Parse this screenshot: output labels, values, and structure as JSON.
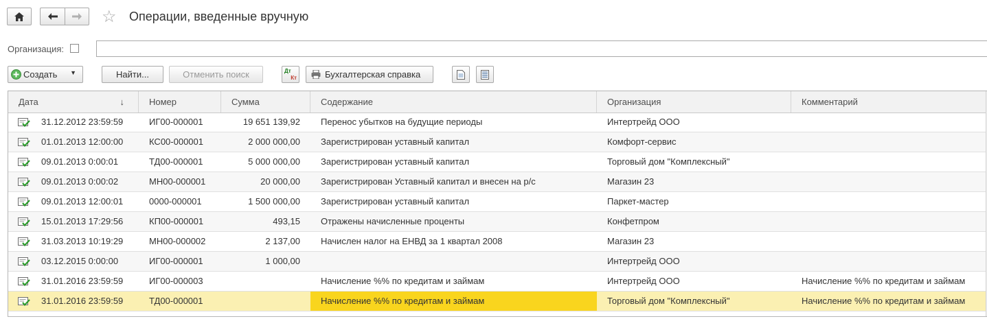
{
  "header": {
    "title": "Операции, введенные вручную"
  },
  "filter": {
    "org_label": "Организация:",
    "org_value": ""
  },
  "toolbar": {
    "create_label": "Создать",
    "find_label": "Найти...",
    "cancel_search_label": "Отменить поиск",
    "report_label": "Бухгалтерская справка",
    "dtkt_icon_text_top": "Дт",
    "dtkt_icon_text_bottom": "Кт"
  },
  "table": {
    "columns": [
      "Дата",
      "Номер",
      "Сумма",
      "Содержание",
      "Организация",
      "Комментарий"
    ],
    "sort_indicator": "↓",
    "rows": [
      {
        "date": "31.12.2012 23:59:59",
        "number": "ИГ00-000001",
        "sum": "19 651 139,92",
        "content": "Перенос убытков на будущие периоды",
        "org": "Интертрейд ООО",
        "comment": ""
      },
      {
        "date": "01.01.2013 12:00:00",
        "number": "КС00-000001",
        "sum": "2 000 000,00",
        "content": "Зарегистрирован уставный капитал",
        "org": "Комфорт-сервис",
        "comment": ""
      },
      {
        "date": "09.01.2013 0:00:01",
        "number": "ТД00-000001",
        "sum": "5 000 000,00",
        "content": "Зарегистрирован уставный капитал",
        "org": "Торговый дом \"Комплексный\"",
        "comment": ""
      },
      {
        "date": "09.01.2013 0:00:02",
        "number": "МН00-000001",
        "sum": "20 000,00",
        "content": "Зарегистрирован Уставный капитал и внесен на р/с",
        "org": "Магазин 23",
        "comment": ""
      },
      {
        "date": "09.01.2013 12:00:01",
        "number": "0000-000001",
        "sum": "1 500 000,00",
        "content": "Зарегистрирован уставный капитал",
        "org": "Паркет-мастер",
        "comment": ""
      },
      {
        "date": "15.01.2013 17:29:56",
        "number": "КП00-000001",
        "sum": "493,15",
        "content": "Отражены начисленные проценты",
        "org": "Конфетпром",
        "comment": ""
      },
      {
        "date": "31.03.2013 10:19:29",
        "number": "МН00-000002",
        "sum": "2 137,00",
        "content": "Начислен налог на ЕНВД за 1 квартал 2008",
        "org": "Магазин 23",
        "comment": ""
      },
      {
        "date": "03.12.2015 0:00:00",
        "number": "ИГ00-000001",
        "sum": "1 000,00",
        "content": "",
        "org": "Интертрейд ООО",
        "comment": ""
      },
      {
        "date": "31.01.2016 23:59:59",
        "number": "ИГ00-000003",
        "sum": "",
        "content": "Начисление %% по кредитам и займам",
        "org": "Интертрейд ООО",
        "comment": "Начисление %% по кредитам и займам"
      },
      {
        "date": "31.01.2016 23:59:59",
        "number": "ТД00-000001",
        "sum": "",
        "content": "Начисление %% по кредитам и займам",
        "org": "Торговый дом \"Комплексный\"",
        "comment": "Начисление %% по кредитам и займам"
      }
    ]
  },
  "colors": {
    "selected_row": "#fbf0b2",
    "selected_cell": "#f9d51e",
    "header_bg": "#f2f2f2"
  }
}
